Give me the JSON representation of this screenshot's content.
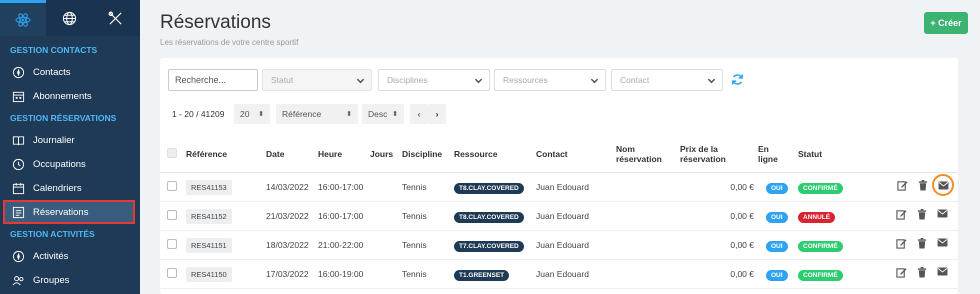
{
  "sidebar": {
    "sections": [
      {
        "title": "GESTION CONTACTS",
        "items": [
          {
            "label": "Contacts",
            "icon": "compass-icon"
          },
          {
            "label": "Abonnements",
            "icon": "calendar-icon"
          }
        ]
      },
      {
        "title": "GESTION RÉSERVATIONS",
        "items": [
          {
            "label": "Journalier",
            "icon": "book-icon"
          },
          {
            "label": "Occupations",
            "icon": "clock-icon"
          },
          {
            "label": "Calendriers",
            "icon": "calendar-icon"
          },
          {
            "label": "Réservations",
            "icon": "list-icon",
            "active": true
          }
        ]
      },
      {
        "title": "GESTION ACTIVITÉS",
        "items": [
          {
            "label": "Activités",
            "icon": "compass-icon"
          },
          {
            "label": "Groupes",
            "icon": "users-icon"
          }
        ]
      }
    ]
  },
  "header": {
    "title": "Réservations",
    "subtitle": "Les réservations de votre centre sportif",
    "create_label": "+ Créer"
  },
  "filters": {
    "search_placeholder": "Recherche...",
    "statut": "Statut",
    "disciplines": "Disciplines",
    "ressources": "Ressources",
    "contact": "Contact"
  },
  "pagination": {
    "range": "1 - 20 / 41209",
    "per_page": "20",
    "sort_field": "Référence",
    "sort_dir": "Desc",
    "prev": "‹",
    "next": "›"
  },
  "table": {
    "headers": {
      "reference": "Référence",
      "date": "Date",
      "heure": "Heure",
      "jours": "Jours",
      "discipline": "Discipline",
      "ressource": "Ressource",
      "contact": "Contact",
      "nom_res_1": "Nom",
      "nom_res_2": "réservation",
      "prix_1": "Prix de la",
      "prix_2": "réservation",
      "enligne_1": "En",
      "enligne_2": "ligne",
      "statut": "Statut"
    },
    "rows": [
      {
        "ref": "RES41153",
        "date": "14/03/2022",
        "heure": "16:00-17:00",
        "discipline": "Tennis",
        "ressource": "T8.CLAY.COVERED",
        "contact": "Juan Edouard",
        "prix": "0,00 €",
        "enligne": "OUI",
        "statut": "CONFIRMÉ",
        "statut_color": "#2ecc71"
      },
      {
        "ref": "RES41152",
        "date": "21/03/2022",
        "heure": "16:00-17:00",
        "discipline": "Tennis",
        "ressource": "T8.CLAY.COVERED",
        "contact": "Juan Edouard",
        "prix": "0,00 €",
        "enligne": "OUI",
        "statut": "ANNULÉ",
        "statut_color": "#d9232e"
      },
      {
        "ref": "RES41151",
        "date": "18/03/2022",
        "heure": "21:00-22:00",
        "discipline": "Tennis",
        "ressource": "T7.CLAY.COVERED",
        "contact": "Juan Edouard",
        "prix": "0,00 €",
        "enligne": "OUI",
        "statut": "CONFIRMÉ",
        "statut_color": "#2ecc71"
      },
      {
        "ref": "RES41150",
        "date": "17/03/2022",
        "heure": "16:00-19:00",
        "discipline": "Tennis",
        "ressource": "T1.GREENSET",
        "contact": "Juan Edouard",
        "prix": "0,00 €",
        "enligne": "OUI",
        "statut": "CONFIRMÉ",
        "statut_color": "#2ecc71"
      }
    ]
  }
}
